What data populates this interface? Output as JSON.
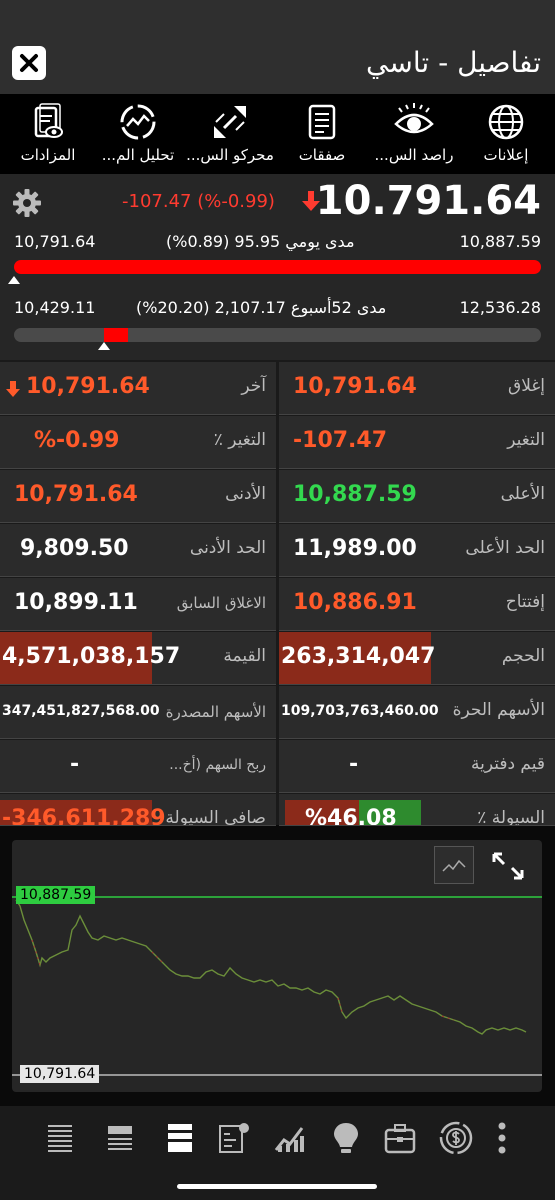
{
  "header": {
    "title": "تفاصيل - تاسي"
  },
  "toolbar": [
    {
      "label": "إعلانات",
      "icon": "globe-icon"
    },
    {
      "label": "راصد الس...",
      "icon": "eye-icon"
    },
    {
      "label": "صفقات",
      "icon": "document-list-icon"
    },
    {
      "label": "محركو الس...",
      "icon": "expand-arrows-icon"
    },
    {
      "label": "تحليل الم...",
      "icon": "cycle-analysis-icon"
    },
    {
      "label": "المزادات",
      "icon": "auction-document-icon"
    }
  ],
  "quote": {
    "last_price": "10.791.64",
    "change_text": "-107.47 (%-0.99)",
    "daily": {
      "low": "10,791.64",
      "high": "10,887.59",
      "label": "مدى يومي 95.95 (0.89%)",
      "position": 0.0
    },
    "week52": {
      "low": "10,429.11",
      "high": "12,536.28",
      "label": "مدى 52أسبوع 2,107.17 (20.20%)",
      "position": 0.17
    }
  },
  "stats": {
    "close_label": "إغلاق",
    "close_value": "10,791.64",
    "last_label": "آخر",
    "last_value": "10,791.64",
    "change_label": "التغير",
    "change_value": "-107.47",
    "change_pct_label": "التغير ٪",
    "change_pct_value": "%-0.99",
    "high_label": "الأعلى",
    "high_value": "10,887.59",
    "low_label": "الأدنى",
    "low_value": "10,791.64",
    "limit_up_label": "الحد الأعلى",
    "limit_up_value": "11,989.00",
    "limit_down_label": "الحد الأدنى",
    "limit_down_value": "9,809.50",
    "open_label": "إفتتاح",
    "open_value": "10,886.91",
    "prev_close_label": "الاغلاق السابق",
    "prev_close_value": "10,899.11",
    "volume_label": "الحجم",
    "volume_value": "263,314,047",
    "value_label": "القيمة",
    "value_value": "4,571,038,157",
    "free_shares_label": "الأسهم الحرة",
    "free_shares_value": "109,703,763,460.00",
    "issued_shares_label": "الأسهم المصدرة",
    "issued_shares_value": "347,451,827,568.00",
    "book_value_label": "قيم دفترية",
    "book_value_value": "-",
    "eps_label": "ربح السهم (أخ...",
    "eps_value": "-",
    "liquidity_label": "السيولة ٪",
    "liquidity_value": "%46.08",
    "net_liquidity_label": "صافي السيولة",
    "net_liquidity_value": "-346,611,289"
  },
  "chart": {
    "high_tag": "10,887.59",
    "low_tag": "10,791.64"
  },
  "colors": {
    "red": "#ff3b30",
    "green": "#33d94f",
    "orange": "#ff5a2a",
    "dark_red_cell": "#8b2a1a"
  },
  "bottom_nav": [
    "list-icon",
    "list-alt-icon",
    "list-bold-icon",
    "settings-board-icon",
    "trend-chart-icon",
    "lightbulb-icon",
    "briefcase-icon",
    "dollar-cycle-icon",
    "more-icon"
  ]
}
